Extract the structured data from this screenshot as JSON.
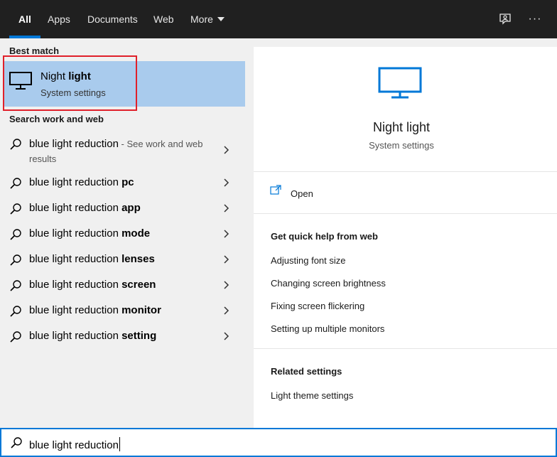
{
  "tabs": [
    {
      "label": "All",
      "active": true
    },
    {
      "label": "Apps"
    },
    {
      "label": "Documents"
    },
    {
      "label": "Web"
    },
    {
      "label": "More"
    }
  ],
  "toolbar_icons": [
    "feedback-icon",
    "more-options-icon"
  ],
  "more_options_label": "···",
  "best_match": {
    "heading": "Best match",
    "title_plain": "Night ",
    "title_bold": "light",
    "subtitle": "System settings",
    "icon": "monitor-icon"
  },
  "search_web": {
    "heading": "Search work and web",
    "items": [
      {
        "prefix": "blue light reduction",
        "bold": "",
        "hint": " - See work and web results"
      },
      {
        "prefix": "blue light reduction ",
        "bold": "pc"
      },
      {
        "prefix": "blue light reduction ",
        "bold": "app"
      },
      {
        "prefix": "blue light reduction ",
        "bold": "mode"
      },
      {
        "prefix": "blue light reduction ",
        "bold": "lenses"
      },
      {
        "prefix": "blue light reduction ",
        "bold": "screen"
      },
      {
        "prefix": "blue light reduction ",
        "bold": "monitor"
      },
      {
        "prefix": "blue light reduction ",
        "bold": "setting"
      }
    ]
  },
  "detail": {
    "title": "Night light",
    "subtitle": "System settings",
    "open_label": "Open",
    "quick_help_heading": "Get quick help from web",
    "quick_help_links": [
      "Adjusting font size",
      "Changing screen brightness",
      "Fixing screen flickering",
      "Setting up multiple monitors"
    ],
    "related_heading": "Related settings",
    "related_links": [
      "Light theme settings"
    ]
  },
  "search": {
    "value": "blue light reduction"
  },
  "colors": {
    "accent": "#0078d7",
    "selection": "#a9cbed",
    "highlight_box": "#e0202a",
    "topbar": "#202020"
  }
}
